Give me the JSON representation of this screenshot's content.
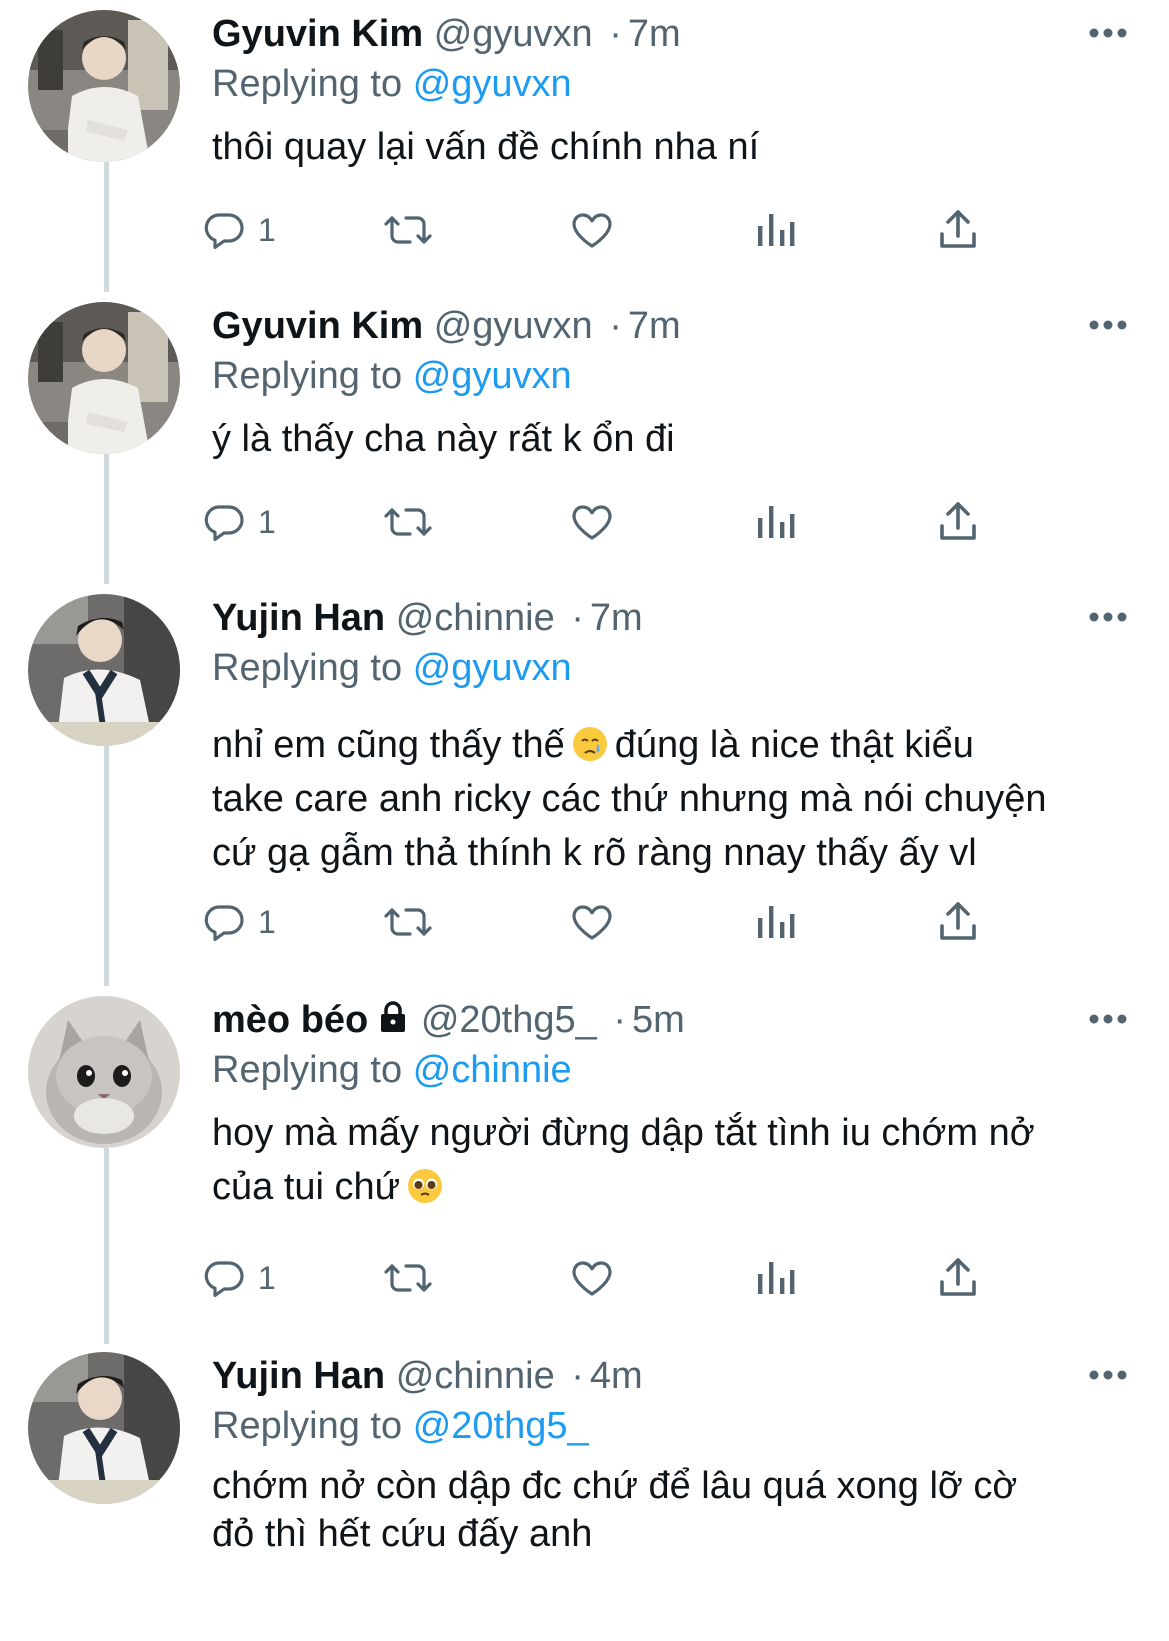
{
  "tweets": [
    {
      "name": "Gyuvin Kim",
      "handle": "@gyuvxn",
      "sep": "·",
      "time": "7m",
      "replying_label": "Replying to",
      "replying_to": "@gyuvxn",
      "text": "thôi quay lại vấn đề chính nha ní",
      "reply_count": "1",
      "avatar": "person-photo"
    },
    {
      "name": "Gyuvin Kim",
      "handle": "@gyuvxn",
      "sep": "·",
      "time": "7m",
      "replying_label": "Replying to",
      "replying_to": "@gyuvxn",
      "text": "ý là thấy cha này rất k ổn đi",
      "reply_count": "1",
      "avatar": "person-photo"
    },
    {
      "name": "Yujin Han",
      "handle": "@chinnie",
      "sep": "·",
      "time": "7m",
      "replying_label": "Replying to",
      "replying_to": "@gyuvxn",
      "text_a": "nhỉ em cũng thấy thế",
      "text_b": "đúng là nice thật kiểu\ntake care anh ricky các thứ nhưng mà nói chuyện\ncứ gạ gẫm thả thính k rõ ràng nnay thấy ấy vl",
      "emoji": "crying-face-emoji",
      "reply_count": "1",
      "avatar": "person-photo"
    },
    {
      "name": "mèo béo",
      "handle": "@20thg5_",
      "sep": "·",
      "time": "5m",
      "replying_label": "Replying to",
      "replying_to": "@chinnie",
      "text": "hoy mà mấy người đừng dập tắt tình iu chớm nở\ncủa tui chứ",
      "emoji": "pleading-face-emoji",
      "reply_count": "1",
      "avatar": "kitten-photo",
      "protected_icon": "lock-icon"
    },
    {
      "name": "Yujin Han",
      "handle": "@chinnie",
      "sep": "·",
      "time": "4m",
      "replying_label": "Replying to",
      "replying_to": "@20thg5_",
      "text": "chớm nở còn dập đc chứ để lâu quá xong lỡ cờ\nđỏ thì hết cứu đấy anh",
      "avatar": "person-photo"
    }
  ],
  "icons": {
    "more": "more-dots-icon",
    "reply": "reply-bubble-icon",
    "retweet": "retweet-icon",
    "like": "heart-icon",
    "views": "analytics-icon",
    "share": "share-icon"
  },
  "colors": {
    "text": "#0f1419",
    "secondary": "#536471",
    "link": "#1d9bf0",
    "thread_line": "#cfd9de"
  }
}
